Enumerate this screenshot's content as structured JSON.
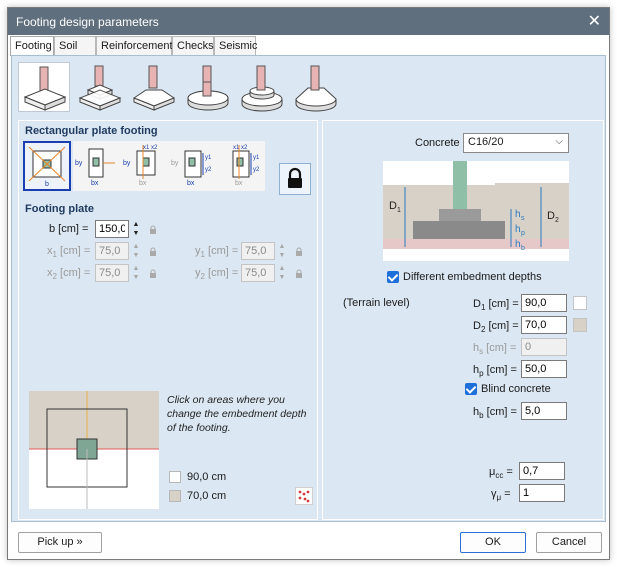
{
  "window": {
    "title": "Footing design parameters",
    "close": "✕"
  },
  "tabs": [
    "Footing",
    "Soil",
    "Reinforcement",
    "Checks",
    "Seismic"
  ],
  "footing_types": [
    "isolated-footing",
    "stepped-footing",
    "sloped-footing",
    "circular-footing",
    "stepped-circular-footing",
    "sloped-circular-footing"
  ],
  "left": {
    "plate_title": "Rectangular plate footing",
    "plate_sub_labels": [
      "b",
      "bx",
      "bx",
      "bx",
      "bx"
    ],
    "plate_by_labels": [
      "by",
      "by",
      "by",
      "by"
    ],
    "plate_xy_labels": [
      "x1 x2",
      "y1",
      "y2",
      "x1 x2",
      "y1",
      "y2"
    ],
    "footing_plate_title": "Footing plate",
    "b": {
      "label": "b [cm] =",
      "value": "150,0"
    },
    "x1": {
      "label_main": "x",
      "label_sub": "1",
      "label_rest": " [cm] =",
      "value": "75,0"
    },
    "x2": {
      "label_main": "x",
      "label_sub": "2",
      "label_rest": " [cm] =",
      "value": "75,0"
    },
    "y1": {
      "label_main": "y",
      "label_sub": "1",
      "label_rest": " [cm] =",
      "value": "75,0"
    },
    "y2": {
      "label_main": "y",
      "label_sub": "2",
      "label_rest": " [cm] =",
      "value": "75,0"
    },
    "note": "Click on areas where you change the embedment depth of the footing.",
    "legend": [
      {
        "label": "90,0 cm",
        "color": "#ffffff"
      },
      {
        "label": "70,0 cm",
        "color": "#d8d1c7"
      }
    ]
  },
  "right": {
    "concrete_label": "Concrete",
    "concrete_value": "C16/20",
    "diagram_labels": {
      "D1": "D",
      "D1_sub": "1",
      "D2": "D",
      "D2_sub": "2",
      "hs": "h",
      "hs_sub": "s",
      "hp": "h",
      "hp_sub": "p",
      "hb": "h",
      "hb_sub": "b"
    },
    "different_depths": "Different embedment depths",
    "terrain_level": "(Terrain level)",
    "D1": {
      "label": "D",
      "sub": "1",
      "rest": " [cm] =",
      "value": "90,0"
    },
    "D2": {
      "label": "D",
      "sub": "2",
      "rest": " [cm] =",
      "value": "70,0"
    },
    "hs": {
      "label": "h",
      "sub": "s",
      "rest": " [cm] =",
      "value": "0"
    },
    "hp": {
      "label": "h",
      "sub": "p",
      "rest": " [cm] =",
      "value": "50,0"
    },
    "blind_concrete": "Blind concrete",
    "hb": {
      "label": "h",
      "sub": "b",
      "rest": " [cm] =",
      "value": "5,0"
    },
    "mucc": {
      "label": "μ",
      "sub": "cc",
      "rest": " =",
      "value": "0,7"
    },
    "gmu": {
      "label": "γ",
      "sub": "μ",
      "rest": " =",
      "value": "1"
    }
  },
  "footer": {
    "pickup": "Pick up »",
    "ok": "OK",
    "cancel": "Cancel"
  },
  "colors": {
    "titlebar": "#5f6f7d",
    "panel": "#dbe7f2",
    "accent": "#1e6fd9",
    "ground": "#d8d1c7",
    "column": "#8fbfa6"
  }
}
